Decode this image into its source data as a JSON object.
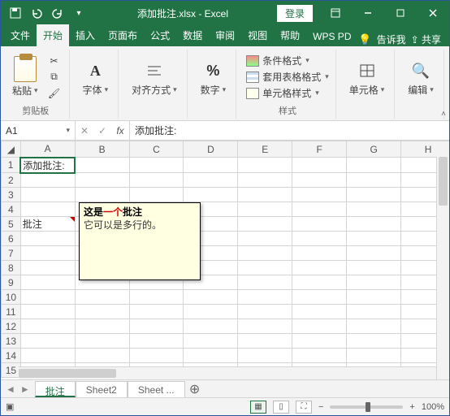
{
  "titlebar": {
    "filename": "添加批注.xlsx - Excel",
    "login": "登录"
  },
  "tabs": {
    "file": "文件",
    "home": "开始",
    "insert": "插入",
    "layout": "页面布",
    "formulas": "公式",
    "data": "数据",
    "review": "审阅",
    "view": "视图",
    "help": "帮助",
    "wps": "WPS PD",
    "tellme": "告诉我",
    "share": "共享"
  },
  "ribbon": {
    "clipboard": {
      "paste": "粘贴",
      "label": "剪贴板"
    },
    "font": {
      "btn": "字体",
      "label": ""
    },
    "align": {
      "btn": "对齐方式",
      "label": ""
    },
    "number": {
      "btn": "数字",
      "label": ""
    },
    "styles": {
      "cond": "条件格式",
      "table": "套用表格格式",
      "cell": "单元格样式",
      "label": "样式"
    },
    "cells": {
      "btn": "单元格",
      "label": ""
    },
    "editing": {
      "btn": "编辑",
      "label": ""
    }
  },
  "fx": {
    "cellref": "A1",
    "value": "添加批注:"
  },
  "gridcols": [
    "A",
    "B",
    "C",
    "D",
    "E",
    "F",
    "G",
    "H"
  ],
  "cells": {
    "A1": "添加批注:",
    "A5": "批注"
  },
  "comment": {
    "author_pre": "这是",
    "author_hl": "一个",
    "author_post": "批注",
    "body": "它可以是多行的。"
  },
  "sheets": {
    "s1": "批注",
    "s2": "Sheet2",
    "s3": "Sheet  ..."
  },
  "status": {
    "zoom": "100%"
  }
}
